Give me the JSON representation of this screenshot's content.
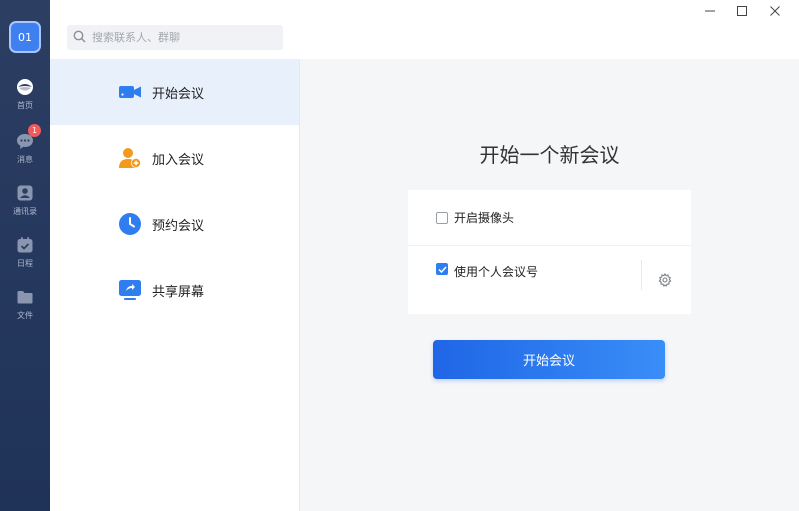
{
  "sidebar": {
    "avatar_text": "01",
    "items": [
      {
        "label": "首页",
        "icon": "home-icon"
      },
      {
        "label": "消息",
        "icon": "message-icon",
        "badge": "1"
      },
      {
        "label": "通讯录",
        "icon": "contacts-icon"
      },
      {
        "label": "日程",
        "icon": "calendar-icon"
      },
      {
        "label": "文件",
        "icon": "folder-icon"
      }
    ],
    "bg_color": "#2c3e62",
    "badge_color": "#f25a5a"
  },
  "search": {
    "placeholder": "搜索联系人、群聊",
    "icon": "search-icon"
  },
  "menu": {
    "items": [
      {
        "label": "开始会议",
        "icon": "video-camera-icon",
        "active": true
      },
      {
        "label": "加入会议",
        "icon": "join-user-icon",
        "active": false
      },
      {
        "label": "预约会议",
        "icon": "clock-icon",
        "active": false
      },
      {
        "label": "共享屏幕",
        "icon": "share-screen-icon",
        "active": false
      }
    ],
    "active_bg": "#e8f0fc"
  },
  "main": {
    "title": "开始一个新会议",
    "options": [
      {
        "label": "开启摄像头",
        "checked": false
      },
      {
        "label": "使用个人会议号",
        "checked": true
      }
    ],
    "settings_icon": "gear-icon",
    "start_button_label": "开始会议",
    "accent_color": "#2f7ef0"
  },
  "window_controls": {
    "minimize": "—",
    "maximize": "☐",
    "close": "✕"
  }
}
